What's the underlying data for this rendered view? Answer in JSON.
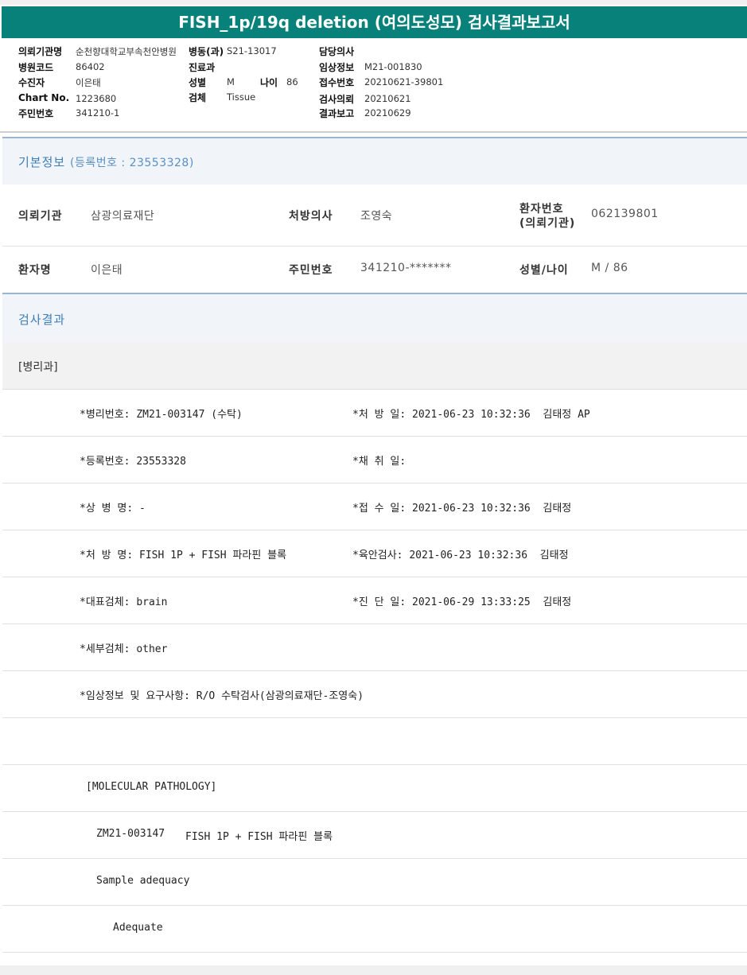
{
  "title": "FISH_1p/19q deletion (여의도성모) 검사결과보고서",
  "header": {
    "c1": [
      {
        "label": "의뢰기관명",
        "value": "순천향대학교부속천안병원"
      },
      {
        "label": "병원코드",
        "value": "86402"
      },
      {
        "label": "수진자",
        "value": "이은태"
      },
      {
        "label": "Chart No.",
        "value": "1223680"
      },
      {
        "label": "주민번호",
        "value": "341210-1"
      }
    ],
    "c2_first_label": "병동(과)",
    "c2_first_value": "S21-13017",
    "c2_treat_label": "진료과",
    "c2_sex_label": "성별",
    "c2_sex_value": "M",
    "c2_age_label": "나이",
    "c2_age_value": "86",
    "c2_spec_label": "검체",
    "c2_spec_value": "Tissue",
    "c3": [
      {
        "label": "담당의사",
        "value": ""
      },
      {
        "label": "임상정보",
        "value": "M21-001830"
      },
      {
        "label": "접수번호",
        "value": "20210621-39801"
      },
      {
        "label": "검사의뢰",
        "value": "20210621"
      },
      {
        "label": "결과보고",
        "value": "20210629"
      }
    ]
  },
  "basic": {
    "title": "기본정보",
    "reg": "(등록번호 : 23553328)",
    "row1": {
      "k1": "의뢰기관",
      "v1": "삼광의료재단",
      "k2": "처방의사",
      "v2": "조영숙",
      "k3a": "환자번호",
      "k3b": "(의뢰기관)",
      "v3": "062139801"
    },
    "row2": {
      "k1": "환자명",
      "v1": "이은태",
      "k2": "주민번호",
      "v2": "341210-*******",
      "k3": "성별/나이",
      "v3": "M / 86"
    }
  },
  "result": {
    "title": "검사결과",
    "dept": "[병리과]",
    "rows": [
      {
        "left": "*병리번호: ZM21-003147 (수탁)",
        "right": "*처 방 일: 2021-06-23 10:32:36  김태정 AP"
      },
      {
        "left": "*등록번호: 23553328",
        "right": "*채 취 일:"
      },
      {
        "left": "*상 병 명: -",
        "right": "*접 수 일: 2021-06-23 10:32:36  김태정"
      },
      {
        "left": "*처 방 명: FISH 1P + FISH 파라핀 블록",
        "right": "*육안검사: 2021-06-23 10:32:36  김태정"
      },
      {
        "left": "*대표검체: brain",
        "right": "*진 단 일: 2021-06-29 13:33:25  김태정"
      },
      {
        "left": "*세부검체: other",
        "right": ""
      },
      {
        "left": "*임상정보 및 요구사항: R/O 수탁검사(삼광의료재단-조영숙)",
        "right": ""
      }
    ],
    "blank": "",
    "mol": "[MOLECULAR PATHOLOGY]",
    "mol_id": "ZM21-003147",
    "mol_test": "FISH 1P + FISH 파라핀 블록",
    "adequacy_label": "Sample adequacy",
    "adequacy_value": "Adequate"
  }
}
